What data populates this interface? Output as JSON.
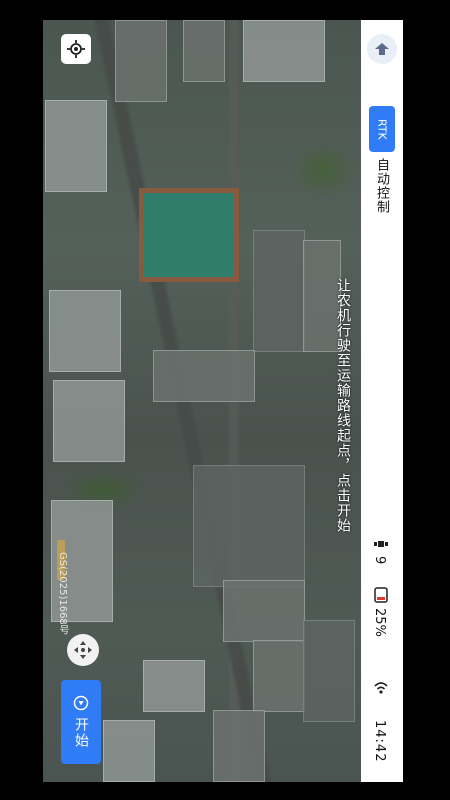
{
  "status_bar": {
    "rtk_label": "RTK",
    "mode_label": "自动控制",
    "satellite_count": "9",
    "battery_percent": "25%",
    "clock": "14:42",
    "icons": [
      "home-arrow-icon",
      "satellite-icon",
      "battery-icon",
      "wifi-icon"
    ]
  },
  "map": {
    "instruction": "让农机行驶至运输路线起点，点击开始",
    "attribution": "GS(2025)1668号"
  },
  "controls": {
    "start_label": "开始"
  },
  "colors": {
    "accent": "#2f7cf6",
    "statusbar_bg": "#ffffff"
  }
}
